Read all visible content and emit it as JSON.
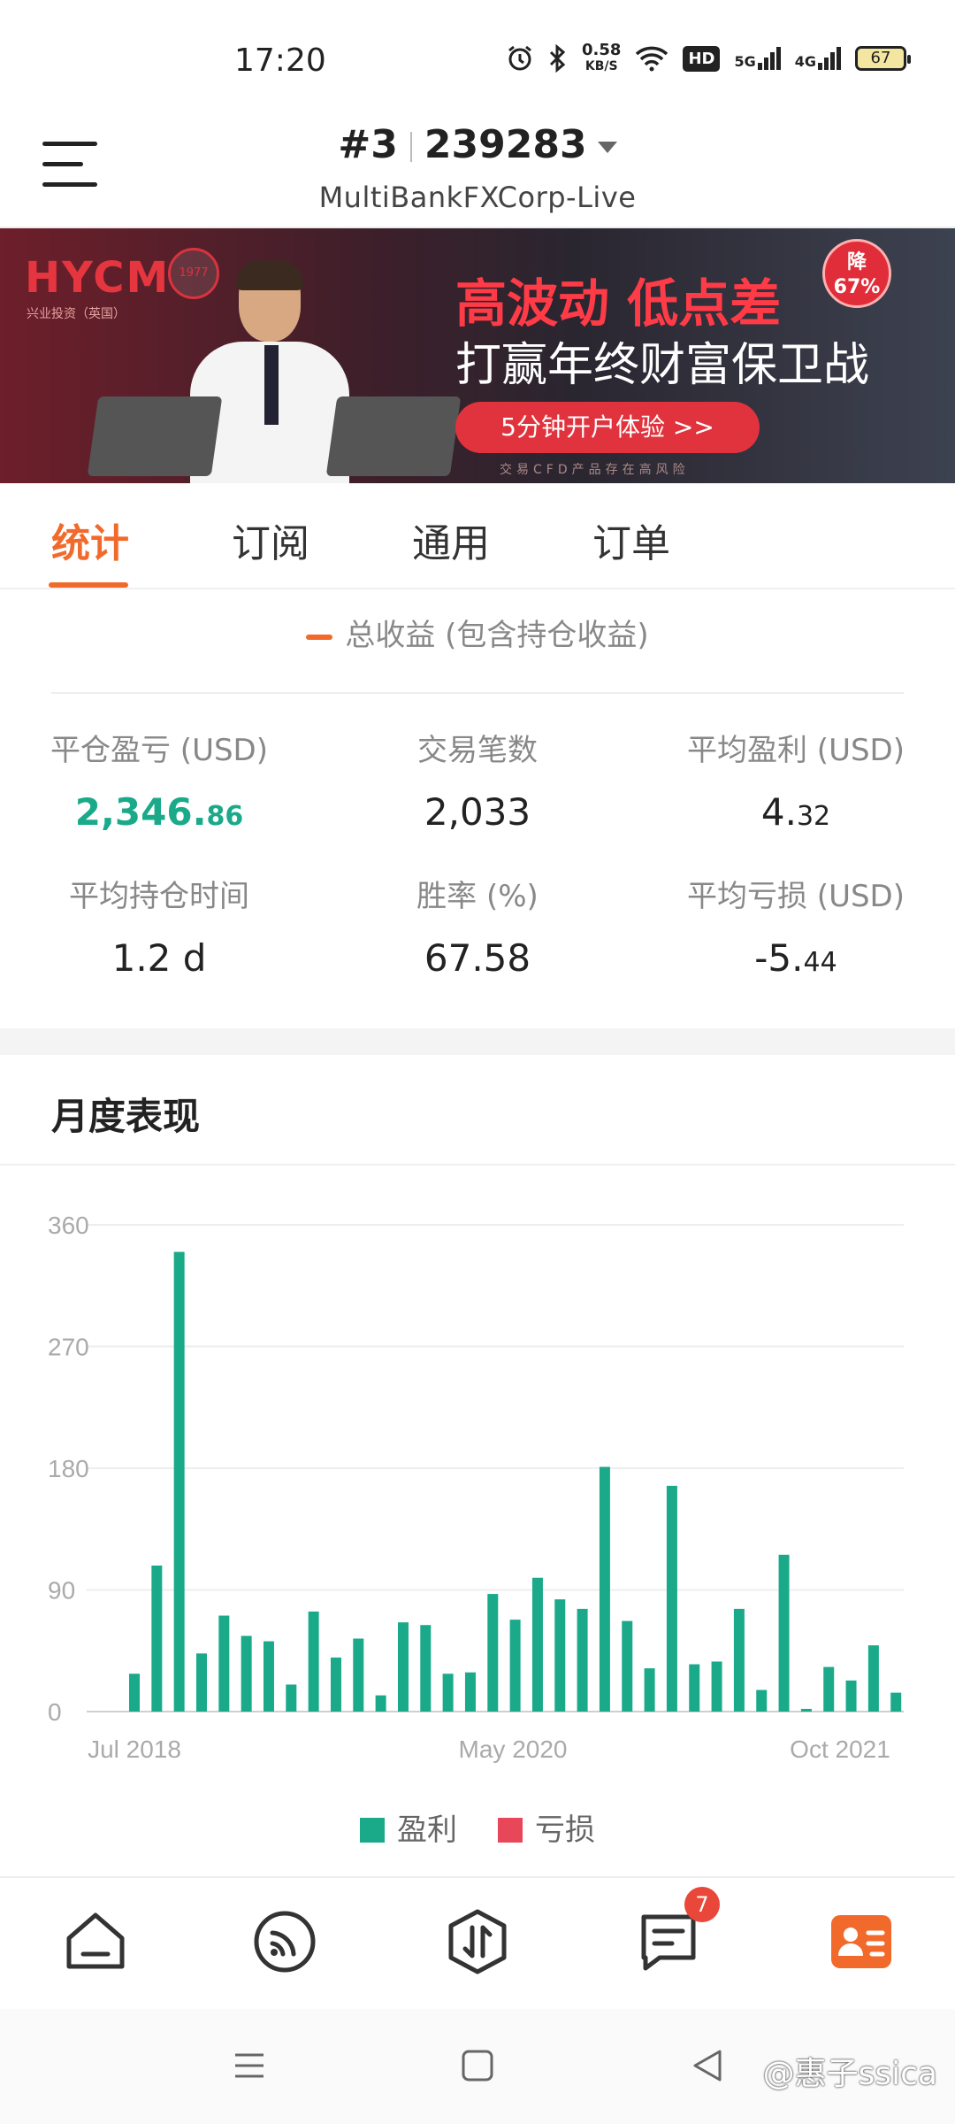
{
  "status": {
    "time": "17:20",
    "net_speed_value": "0.58",
    "net_speed_unit": "KB/S",
    "hd_label": "HD",
    "sig1_label": "5G",
    "sig2_label": "4G",
    "battery": "67"
  },
  "header": {
    "account_index": "#3",
    "account_number": "239283",
    "server": "MultiBankFXCorp-Live"
  },
  "banner": {
    "logo": "HYCM",
    "logo_sub": "兴业投资（英国）",
    "seal": "1977",
    "title": "高波动 低点差",
    "badge_line1": "降",
    "badge_line2": "67%",
    "subtitle": "打赢年终财富保卫战",
    "cta": "5分钟开户体验 >>",
    "note": "交易CFD产品存在高风险"
  },
  "tabs": [
    {
      "label": "统计",
      "active": true
    },
    {
      "label": "订阅",
      "active": false
    },
    {
      "label": "通用",
      "active": false
    },
    {
      "label": "订单",
      "active": false
    }
  ],
  "summary": {
    "legend": "总收益 (包含持仓收益)",
    "stats": [
      {
        "label": "平仓盈亏 (USD)",
        "value_main": "2,346.",
        "value_dec": "86"
      },
      {
        "label": "交易笔数",
        "value_main": "2,033",
        "value_dec": ""
      },
      {
        "label": "平均盈利 (USD)",
        "value_main": "4.",
        "value_dec": "32"
      },
      {
        "label": "平均持仓时间",
        "value_main": "1.2 d",
        "value_dec": ""
      },
      {
        "label": "胜率 (%)",
        "value_main": "67.58",
        "value_dec": ""
      },
      {
        "label": "平均亏损 (USD)",
        "value_main": "-5.",
        "value_dec": "44"
      }
    ]
  },
  "monthly": {
    "title": "月度表现",
    "legend_profit": "盈利",
    "legend_loss": "亏损"
  },
  "colors": {
    "accent": "#f26a2b",
    "profit": "#1aaa8a",
    "loss": "#e8475a"
  },
  "chart_data": {
    "type": "bar",
    "title": "月度表现",
    "x_tick_labels": [
      "Jul 2018",
      "May 2020",
      "Oct 2021"
    ],
    "y_ticks": [
      0,
      90,
      180,
      270,
      360
    ],
    "ylim": [
      0,
      360
    ],
    "grid": true,
    "legend_position": "bottom",
    "series": [
      {
        "name": "盈利",
        "color": "#1aaa8a",
        "values": [
          28,
          108,
          340,
          43,
          71,
          56,
          52,
          20,
          74,
          40,
          54,
          12,
          66,
          64,
          28,
          29,
          87,
          68,
          99,
          83,
          76,
          181,
          67,
          32,
          167,
          35,
          37,
          76,
          16,
          116,
          2,
          33,
          23,
          49,
          14
        ]
      },
      {
        "name": "亏损",
        "color": "#e8475a",
        "values": [
          0,
          0,
          0,
          0,
          0,
          0,
          0,
          0,
          0,
          0,
          0,
          0,
          0,
          0,
          0,
          0,
          0,
          0,
          0,
          0,
          0,
          0,
          0,
          0,
          0,
          0,
          0,
          0,
          0,
          0,
          0,
          0,
          0,
          0,
          0
        ]
      }
    ]
  },
  "watermark": "@惠子ssica"
}
